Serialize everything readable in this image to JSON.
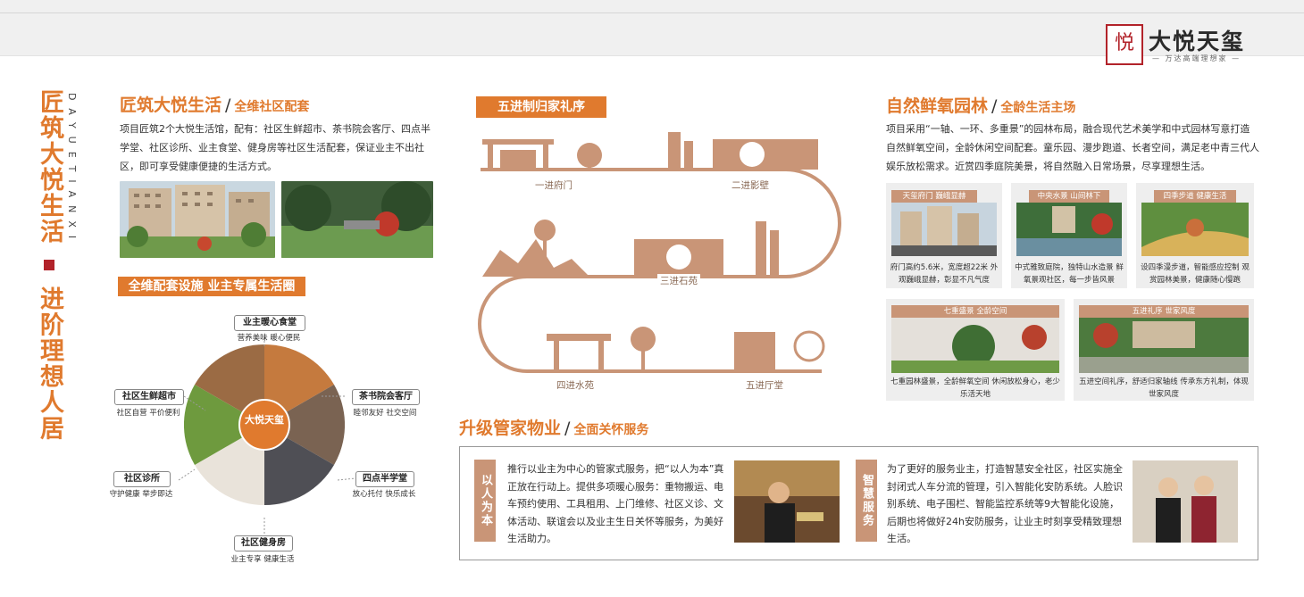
{
  "brand": {
    "seal_glyph": "悦",
    "name": "大悦天玺",
    "tagline": "— 万达高端理想家 —"
  },
  "side": {
    "title_top": "匠筑大悦生活",
    "title_bottom": "进阶理想人居",
    "pinyin": "DAYUETIANXI"
  },
  "section1": {
    "title": "匠筑大悦生活",
    "subtitle": "全维社区配套",
    "text": "项目匠筑2个大悦生活馆，配有：社区生鲜超市、茶书院会客厅、四点半学堂、社区诊所、业主食堂、健身房等社区生活配套，保证业主不出社区，即可享受健康便捷的生活方式。"
  },
  "section2": {
    "banner": "全维配套设施 业主专属生活圈",
    "center_logo": "大悦天玺",
    "nodes": [
      {
        "name": "业主暖心食堂",
        "desc": "营养美味 暖心便民"
      },
      {
        "name": "社区生鲜超市",
        "desc": "社区自营 平价便利"
      },
      {
        "name": "茶书院会客厅",
        "desc": "睦邻友好 社交空间"
      },
      {
        "name": "社区诊所",
        "desc": "守护健康 举步即达"
      },
      {
        "name": "四点半学堂",
        "desc": "放心托付 快乐成长"
      },
      {
        "name": "社区健身房",
        "desc": "业主专享 健康生活"
      }
    ]
  },
  "route": {
    "banner": "五进制归家礼序",
    "stages": [
      "一进府门",
      "二进影壁",
      "三进石苑",
      "四进水苑",
      "五进厅堂"
    ]
  },
  "garden": {
    "title": "自然鲜氧园林",
    "subtitle": "全龄生活主场",
    "text": "项目采用“一轴、一环、多重景”的园林布局，融合现代艺术美学和中式园林写意打造自然鲜氧空间，全龄休闲空间配套。童乐园、漫步跑道、长者空间，满足老中青三代人娱乐放松需求。近赏四季庭院美景，将自然融入日常场景，尽享理想生活。",
    "cards": [
      {
        "label": "天玺府门 巍峨显赫",
        "text": "府门高约5.6米，宽度超22米 外观巍峨显赫，彰显不凡气度"
      },
      {
        "label": "中央水景 山间林下",
        "text": "中式雅致庭院，独特山水造景 鲜氧景观社区，每一步皆风景"
      },
      {
        "label": "四季步道 健康生活",
        "text": "设四季漫步道，智能感应控制 观赏园林美景，健康随心慢跑"
      },
      {
        "label": "七重盛景 全龄空间",
        "text": "七重园林盛景，全龄鲜氧空间 休闲放松身心，老少乐活天地"
      },
      {
        "label": "五进礼序 世家风度",
        "text": "五进空间礼序，舒适归家轴线 传承东方礼制，体现世家风度"
      }
    ]
  },
  "service": {
    "title": "升级管家物业",
    "subtitle": "全面关怀服务",
    "left_tag": "以人为本",
    "left_text": "推行以业主为中心的管家式服务，把“以人为本”真正放在行动上。提供多项暖心服务：重物搬运、电车预约使用、工具租用、上门维修、社区义诊、文体活动、联谊会以及业主生日关怀等服务，为美好生活助力。",
    "right_tag": "智慧服务",
    "right_text": "为了更好的服务业主，打造智慧安全社区，社区实施全封闭式人车分流的管理，引入智能化安防系统。人脸识别系统、电子围栏、智能监控系统等9大智能化设施，后期也将做好24h安防服务，让业主时刻享受精致理想生活。"
  },
  "colors": {
    "accent": "#e07a2e",
    "tan": "#c99577",
    "seal_red": "#b2232a"
  }
}
